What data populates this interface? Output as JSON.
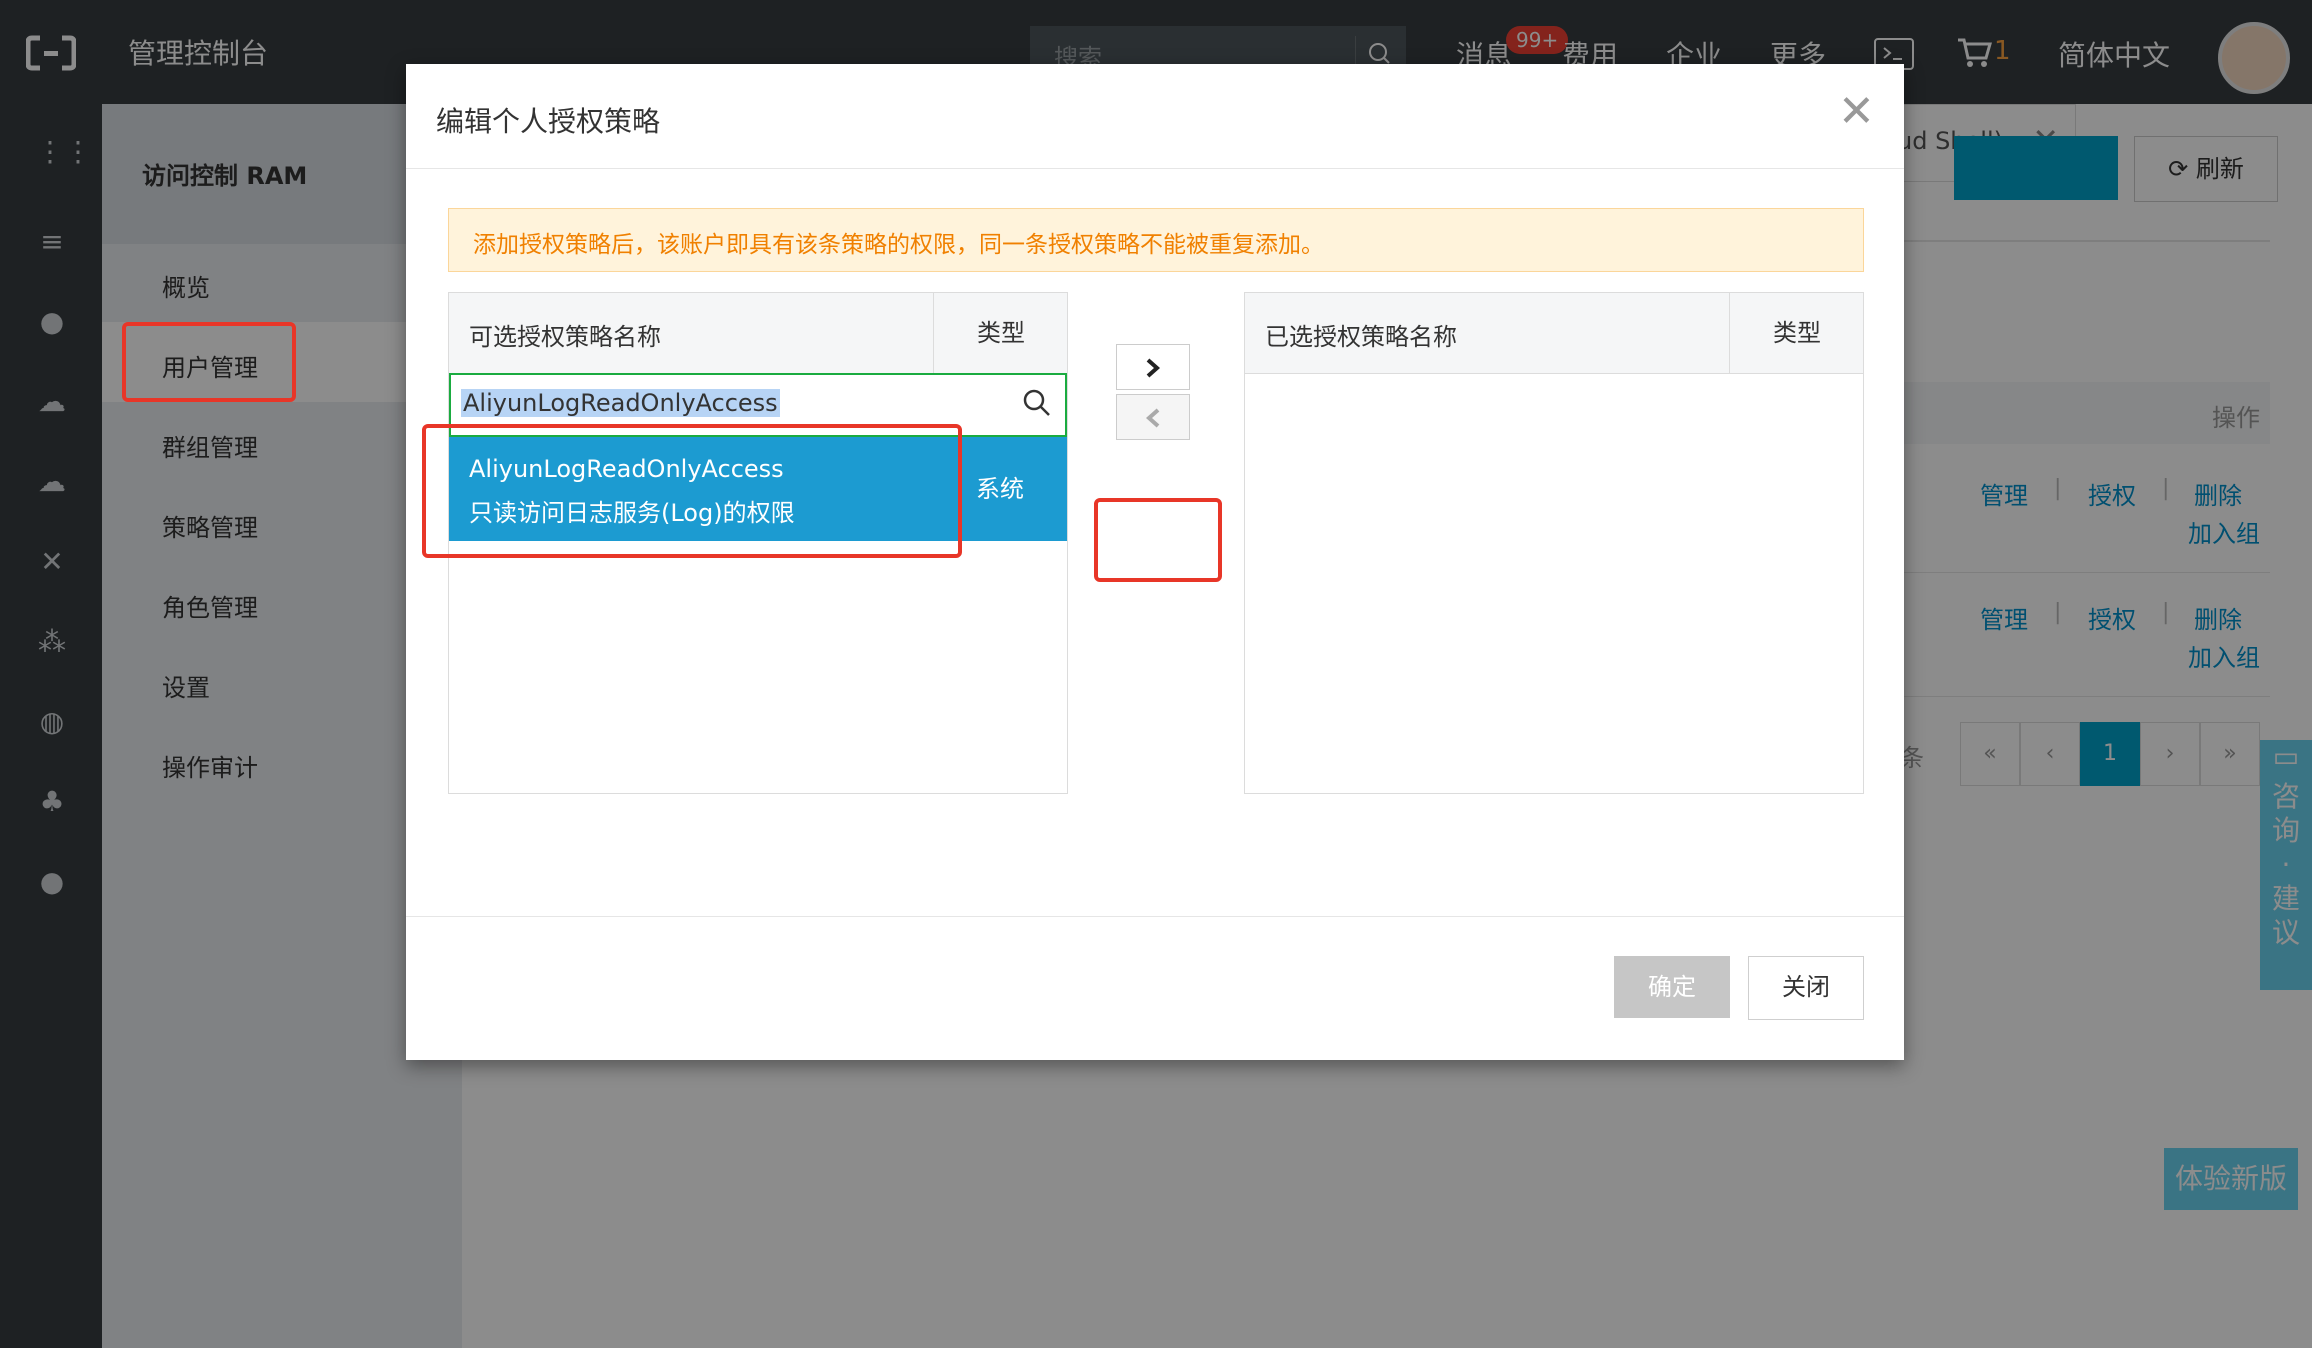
{
  "header": {
    "title": "管理控制台",
    "search_placeholder": "搜索",
    "nav": [
      "消息",
      "费用",
      "企业",
      "更多"
    ],
    "message_badge": "99+",
    "cart_count": "1",
    "language": "简体中文"
  },
  "sidebar": {
    "title": "访问控制 RAM",
    "items": [
      "概览",
      "用户管理",
      "群组管理",
      "策略管理",
      "角色管理",
      "设置",
      "操作审计"
    ],
    "active_index": 1
  },
  "background_page": {
    "cloud_shell_tip": "ud Shell)",
    "refresh_label": "刷新",
    "ops_header": "操作",
    "row_actions": {
      "manage": "管理",
      "authorize": "授权",
      "delete": "删除",
      "add_group": "加入组"
    },
    "page_suffix": "条",
    "pagination": [
      "«",
      "‹",
      "1",
      "›",
      "»"
    ],
    "consult_label": "咨询·建议",
    "new_version_label": "体验新版"
  },
  "modal": {
    "title": "编辑个人授权策略",
    "notice": "添加授权策略后，该账户即具有该条策略的权限，同一条授权策略不能被重复添加。",
    "available": {
      "header_name": "可选授权策略名称",
      "header_type": "类型",
      "search_value": "AliyunLogReadOnlyAccess",
      "results": [
        {
          "name": "AliyunLogReadOnlyAccess",
          "desc": "只读访问日志服务(Log)的权限",
          "type": "系统"
        }
      ]
    },
    "selected": {
      "header_name": "已选授权策略名称",
      "header_type": "类型"
    },
    "confirm_label": "确定",
    "close_label": "关闭"
  },
  "colors": {
    "topbar": "#373d41",
    "accent_blue": "#1c9bd1",
    "highlight_red": "#e83628",
    "notice_text": "#f08000"
  }
}
